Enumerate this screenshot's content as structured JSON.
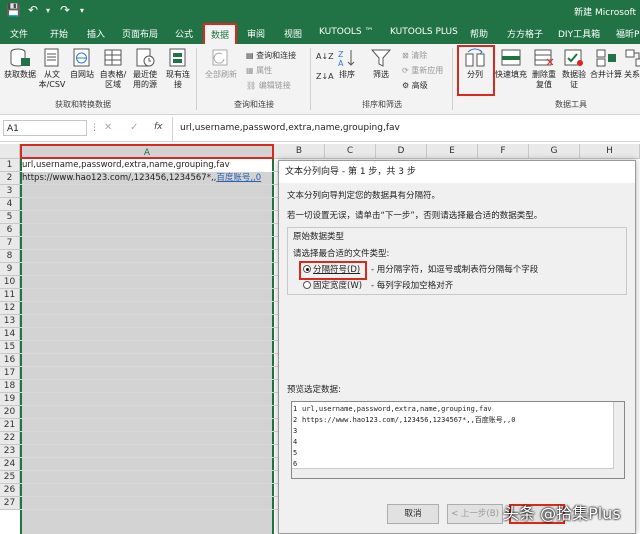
{
  "window": {
    "title": "新建 Microsoft"
  },
  "tabs": [
    "文件",
    "开始",
    "插入",
    "页面布局",
    "公式",
    "数据",
    "审阅",
    "视图",
    "KUTOOLS ™",
    "KUTOOLS PLUS",
    "帮助",
    "方方格子",
    "DIY工具箱",
    "福昕P"
  ],
  "active_tab": "数据",
  "ribbon": {
    "get_data": "获取数据",
    "from_csv": "从文本/CSV",
    "from_web": "自网站",
    "from_table": "自表格/区域",
    "recent_sources": "最近使用的源",
    "existing_conn": "现有连接",
    "group_get_transform": "获取和转换数据",
    "refresh_all": "全部刷新",
    "queries_conn": "查询和连接",
    "properties": "属性",
    "edit_links": "编辑链接",
    "group_queries": "查询和连接",
    "sort_az": "A↓Z",
    "sort_za": "Z↓A",
    "sort": "排序",
    "filter": "筛选",
    "clear": "清除",
    "reapply": "重新应用",
    "advanced": "高级",
    "group_sort_filter": "排序和筛选",
    "text_to_columns": "分列",
    "flash_fill": "快速填充",
    "remove_dup": "删除重复值",
    "data_validation": "数据验证",
    "consolidate": "合并计算",
    "relations": "关系",
    "group_data_tools": "数据工具"
  },
  "formula_bar": {
    "name_box": "A1",
    "cancel": "✕",
    "enter": "✓",
    "fx": "fx",
    "formula": "url,username,password,extra,name,grouping,fav"
  },
  "columns": [
    "A",
    "B",
    "C",
    "D",
    "E",
    "F",
    "G",
    "H"
  ],
  "rows": [
    "1",
    "2",
    "3",
    "4",
    "5",
    "6",
    "7",
    "8",
    "9",
    "10",
    "11",
    "12",
    "13",
    "14",
    "15",
    "16",
    "17",
    "18",
    "19",
    "20",
    "21",
    "22",
    "23",
    "24",
    "25",
    "26",
    "27"
  ],
  "cells": {
    "a1": "url,username,password,extra,name,grouping,fav",
    "a2": "https://www.hao123.com/,123456,1234567*,,",
    "a2_link": "百度账号,,0"
  },
  "dialog": {
    "title": "文本分列向导 - 第 1 步，共 3 步",
    "intro1": "文本分列向导判定您的数据具有分隔符。",
    "intro2": "若一切设置无误，请单击“下一步”，否则请选择最合适的数据类型。",
    "group_label": "原始数据类型",
    "choose_label": "请选择最合适的文件类型:",
    "opt_delimited": "分隔符号(D)",
    "opt_delimited_desc": "- 用分隔字符，如逗号或制表符分隔每个字段",
    "opt_fixed": "固定宽度(W)",
    "opt_fixed_desc": "- 每列字段加空格对齐",
    "preview_label": "预览选定数据:",
    "preview_nums": [
      "1",
      "2",
      "3",
      "4",
      "5",
      "6"
    ],
    "preview_line1": "url,username,password,extra,name,grouping,fav",
    "preview_line2": "https://www.hao123.com/,123456,1234567*,,百度账号,,0",
    "cancel": "取消",
    "back": "< 上一步(B)"
  },
  "watermark": "头条 @拾集Plus"
}
